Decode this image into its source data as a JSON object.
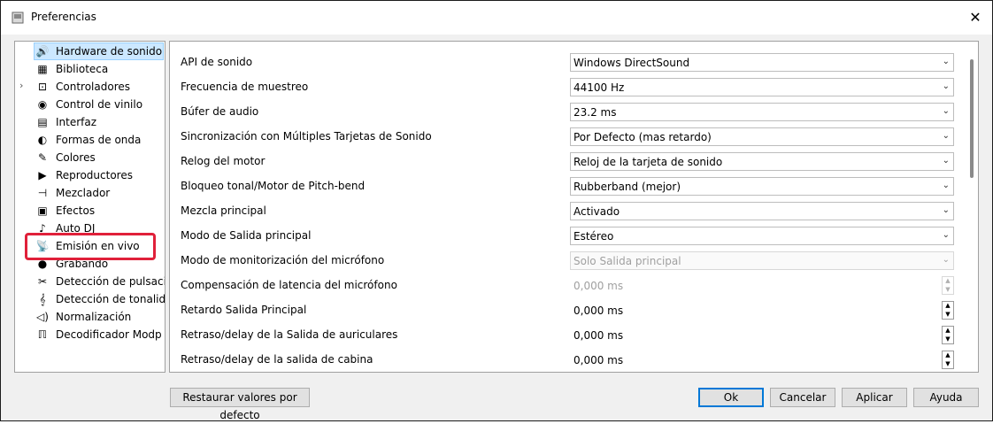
{
  "window": {
    "title": "Preferencias",
    "close_glyph": "✕"
  },
  "sidebar": {
    "items": [
      {
        "label": "Hardware de sonido",
        "icon": "speaker-icon",
        "glyph": "🔊",
        "selected": true
      },
      {
        "label": "Biblioteca",
        "icon": "library-icon",
        "glyph": "▦"
      },
      {
        "label": "Controladores",
        "icon": "controller-icon",
        "glyph": "⊡",
        "expandable": true
      },
      {
        "label": "Control de vinilo",
        "icon": "vinyl-icon",
        "glyph": "◉"
      },
      {
        "label": "Interfaz",
        "icon": "interface-icon",
        "glyph": "▤"
      },
      {
        "label": "Formas de onda",
        "icon": "waveform-icon",
        "glyph": "◐"
      },
      {
        "label": "Colores",
        "icon": "palette-icon",
        "glyph": "✎"
      },
      {
        "label": "Reproductores",
        "icon": "play-icon",
        "glyph": "▶"
      },
      {
        "label": "Mezclador",
        "icon": "mixer-icon",
        "glyph": "⊣"
      },
      {
        "label": "Efectos",
        "icon": "effects-icon",
        "glyph": "▣"
      },
      {
        "label": "Auto DJ",
        "icon": "autodj-icon",
        "glyph": "♪"
      },
      {
        "label": "Emisión en vivo",
        "icon": "broadcast-icon",
        "glyph": "📡"
      },
      {
        "label": "Grabando",
        "icon": "record-icon",
        "glyph": "●"
      },
      {
        "label": "Detección de pulsaci",
        "icon": "beat-detection-icon",
        "glyph": "✂"
      },
      {
        "label": "Detección de tonalid",
        "icon": "key-detection-icon",
        "glyph": "𝄞"
      },
      {
        "label": "Normalización",
        "icon": "normalization-icon",
        "glyph": "◁)"
      },
      {
        "label": "Decodificador Modp",
        "icon": "decoder-icon",
        "glyph": "ℿ"
      }
    ],
    "expand_glyph": "›"
  },
  "settings": [
    {
      "label": "API de sonido",
      "type": "combo",
      "value": "Windows DirectSound"
    },
    {
      "label": "Frecuencia de muestreo",
      "type": "combo",
      "value": "44100 Hz"
    },
    {
      "label": "Búfer de audio",
      "type": "combo",
      "value": "23.2 ms"
    },
    {
      "label": "Sincronización con Múltiples Tarjetas de Sonido",
      "type": "combo",
      "value": "Por Defecto (mas retardo)"
    },
    {
      "label": "Relog del motor",
      "type": "combo",
      "value": "Reloj de la tarjeta de sonido"
    },
    {
      "label": "Bloqueo tonal/Motor de Pitch-bend",
      "type": "combo",
      "value": "Rubberband (mejor)"
    },
    {
      "label": "Mezcla principal",
      "type": "combo",
      "value": "Activado"
    },
    {
      "label": "Modo de Salida principal",
      "type": "combo",
      "value": "Estéreo"
    },
    {
      "label": "Modo de monitorización del micrófono",
      "type": "combo",
      "value": "Solo Salida principal",
      "disabled": true
    },
    {
      "label": "Compensación de latencia del micrófono",
      "type": "spin",
      "value": "0,000 ms",
      "disabled": true
    },
    {
      "label": "Retardo Salida Principal",
      "type": "spin",
      "value": "0,000 ms"
    },
    {
      "label": "Retraso/delay de la Salida de auriculares",
      "type": "spin",
      "value": "0,000 ms"
    },
    {
      "label": "Retraso/delay de la salida de cabina",
      "type": "spin",
      "value": "0,000 ms"
    }
  ],
  "glyphs": {
    "dropdown": "⌄",
    "spin_up": "▲",
    "spin_down": "▼"
  },
  "buttons": {
    "restore": "Restaurar valores por defecto",
    "ok": "Ok",
    "cancel": "Cancelar",
    "apply": "Aplicar",
    "help": "Ayuda"
  },
  "colors": {
    "highlight": "#e0203a",
    "selection": "#cce8ff",
    "default_button": "#0078d7"
  }
}
